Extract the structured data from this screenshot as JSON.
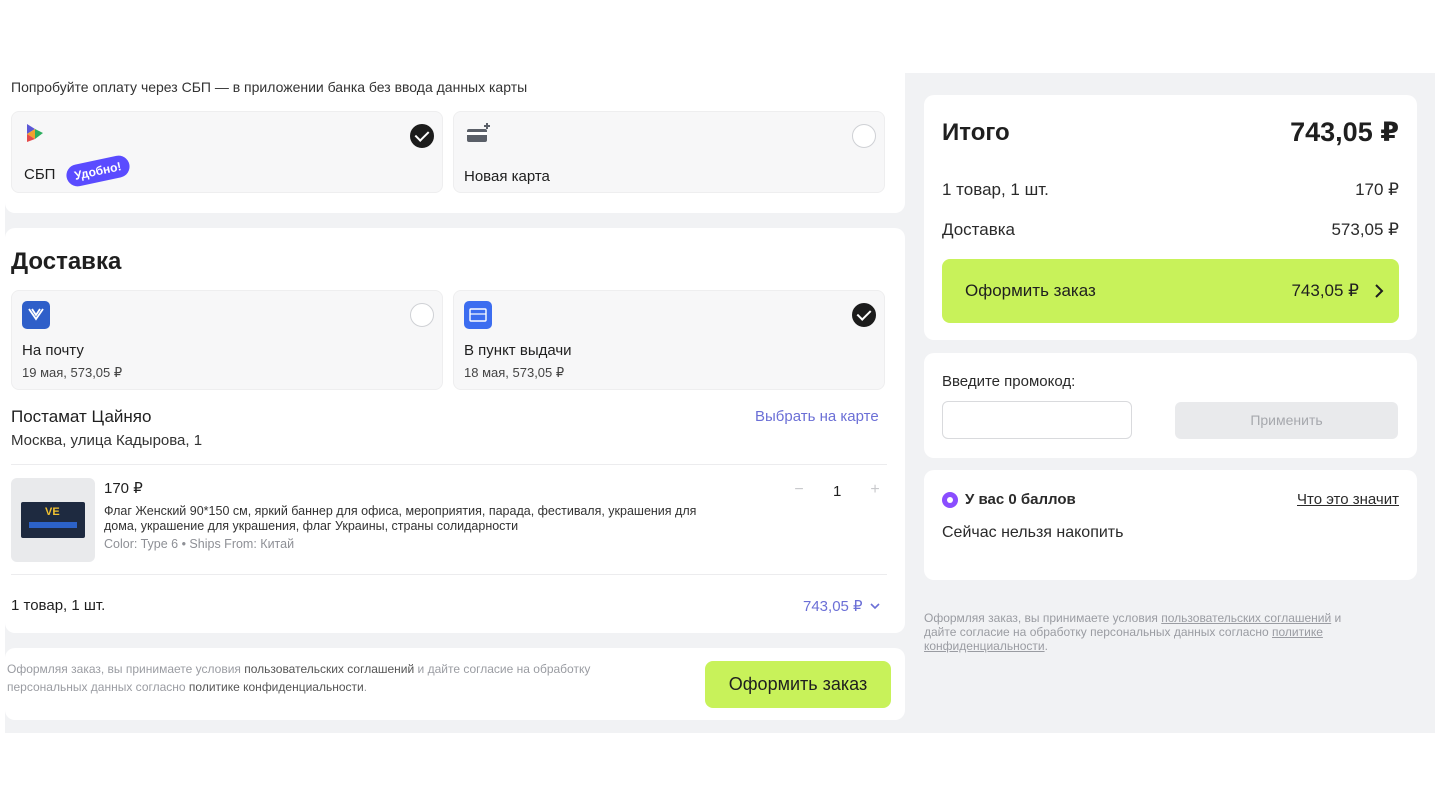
{
  "payment": {
    "hint": "Попробуйте оплату через СБП — в приложении банка без ввода данных карты",
    "options": [
      {
        "label": "СБП",
        "badge": "Удобно!",
        "selected": true,
        "icon": "sbp-icon"
      },
      {
        "label": "Новая карта",
        "selected": false,
        "icon": "new-card-icon"
      }
    ]
  },
  "delivery": {
    "title": "Доставка",
    "options": [
      {
        "label": "На почту",
        "sub": "19 мая, 573,05 ₽",
        "selected": false,
        "icon": "russian-post-icon"
      },
      {
        "label": "В пункт выдачи",
        "sub": "18 мая, 573,05 ₽",
        "selected": true,
        "icon": "pickup-point-icon"
      }
    ],
    "point_name": "Постамат Цайняо",
    "point_address": "Москва, улица Кадырова, 1",
    "choose_on_map": "Выбрать на карте"
  },
  "item": {
    "price": "170 ₽",
    "title_line1": "Флаг Женский 90*150 см, яркий баннер для офиса, мероприятия, парада, фестиваля, украшения для",
    "title_line2": "дома, украшение для украшения, флаг Украины, страны солидарности",
    "attrs": "Color: Type 6 • Ships From: Китай",
    "qty": "1",
    "minus": "−",
    "plus": "+"
  },
  "order_summary_row": {
    "count": "1 товар, 1 шт.",
    "total": "743,05 ₽"
  },
  "bottom": {
    "legal_1": "Оформляя заказ, вы принимаете условия ",
    "legal_link1": "пользовательских соглашений",
    "legal_2": " и дайте согласие на обработку",
    "legal_3": "персональных данных согласно ",
    "legal_link2": "политике конфиденциальности",
    "legal_4": ".",
    "button": "Оформить заказ"
  },
  "summary": {
    "title": "Итого",
    "total": "743,05 ₽",
    "items_label": "1 товар, 1 шт.",
    "items_value": "170 ₽",
    "delivery_label": "Доставка",
    "delivery_value": "573,05 ₽",
    "button_label": "Оформить заказ",
    "button_total": "743,05 ₽"
  },
  "promo": {
    "label": "Введите промокод:",
    "input_value": "",
    "apply": "Применить"
  },
  "bonus": {
    "title": "У вас 0 баллов",
    "link": "Что это значит",
    "note": "Сейчас нельзя накопить"
  },
  "right_legal": {
    "part1": "Оформляя заказ, вы принимаете условия ",
    "link1": "пользовательских соглашений",
    "part2": " и",
    "part3": "дайте согласие на обработку персональных данных согласно ",
    "link2a": "политике",
    "link2b": "конфиденциальности",
    "part4": "."
  },
  "colors": {
    "accent_green": "#c8f25a",
    "link": "#6b6fd6",
    "bonus_purple": "#8a4dff"
  }
}
